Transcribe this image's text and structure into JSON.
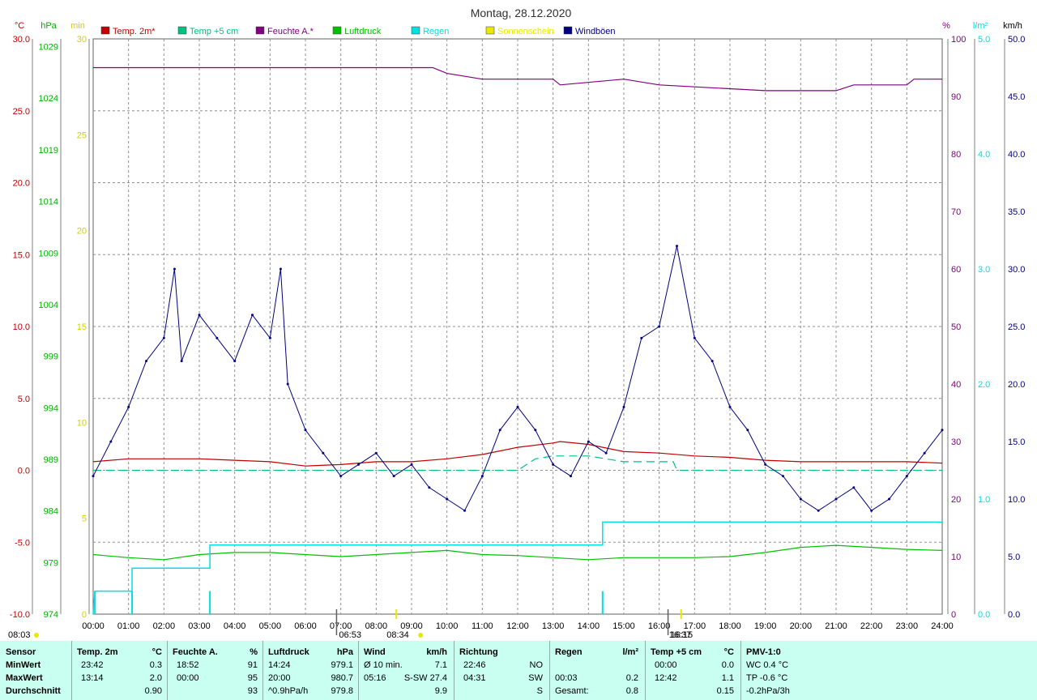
{
  "title": "Montag, 28.12.2020",
  "units": {
    "temp": "°C",
    "pressure": "hPa",
    "sun": "min",
    "humidity": "%",
    "rain": "l/m²",
    "wind": "km/h"
  },
  "legend": [
    {
      "label": "Temp. 2m*",
      "color": "#c00000"
    },
    {
      "label": "Temp +5 cm",
      "color": "#00c080"
    },
    {
      "label": "Feuchte A.*",
      "color": "#800080"
    },
    {
      "label": "Luftdruck",
      "color": "#00c000"
    },
    {
      "label": "Regen",
      "color": "#00e0e0"
    },
    {
      "label": "Sonnenschein",
      "color": "#e8e800"
    },
    {
      "label": "Windböen",
      "color": "#000080"
    }
  ],
  "axes": {
    "temp_ticks": [
      "30.0",
      "25.0",
      "20.0",
      "15.0",
      "10.0",
      "5.0",
      "0.0",
      "-5.0",
      "-10.0"
    ],
    "pressure_ticks": [
      "1029",
      "1024",
      "1019",
      "1014",
      "1009",
      "1004",
      "999",
      "994",
      "989",
      "984",
      "979",
      "974"
    ],
    "sun_ticks": [
      "30",
      "25",
      "20",
      "15",
      "10",
      "5",
      "0"
    ],
    "humidity_ticks": [
      "100",
      "90",
      "80",
      "70",
      "60",
      "50",
      "40",
      "30",
      "20",
      "10",
      "0"
    ],
    "rain_ticks": [
      "5.0",
      "4.0",
      "3.0",
      "2.0",
      "1.0",
      "0.0"
    ],
    "wind_ticks": [
      "50.0",
      "45.0",
      "40.0",
      "35.0",
      "30.0",
      "25.0",
      "20.0",
      "15.0",
      "10.0",
      "5.0",
      "0.0"
    ],
    "hours": [
      "00:00",
      "01:00",
      "02:00",
      "03:00",
      "04:00",
      "05:00",
      "06:00",
      "07:00",
      "08:00",
      "09:00",
      "10:00",
      "11:00",
      "12:00",
      "13:00",
      "14:00",
      "15:00",
      "16:00",
      "17:00",
      "18:00",
      "19:00",
      "20:00",
      "21:00",
      "22:00",
      "23:00",
      "24:00"
    ],
    "sun_events": {
      "left": "08:03",
      "sunrise": "06:53",
      "sunrise2": "08:34",
      "sunset": "16:15",
      "sunset2": "16:37"
    }
  },
  "chart_data": {
    "type": "line",
    "x_unit": "hour of day",
    "xlim": [
      0,
      24
    ],
    "series": [
      {
        "name": "Temp. 2m*",
        "unit": "°C",
        "ylim": [
          -10,
          30
        ],
        "points": [
          [
            0,
            0.6
          ],
          [
            1,
            0.8
          ],
          [
            2,
            0.8
          ],
          [
            3,
            0.8
          ],
          [
            4,
            0.7
          ],
          [
            5,
            0.6
          ],
          [
            6,
            0.3
          ],
          [
            7,
            0.4
          ],
          [
            8,
            0.6
          ],
          [
            9,
            0.6
          ],
          [
            10,
            0.8
          ],
          [
            11,
            1.1
          ],
          [
            12,
            1.6
          ],
          [
            13,
            1.9
          ],
          [
            13.2,
            2.0
          ],
          [
            14,
            1.8
          ],
          [
            15,
            1.3
          ],
          [
            16,
            1.2
          ],
          [
            17,
            1.0
          ],
          [
            18,
            0.9
          ],
          [
            19,
            0.7
          ],
          [
            20,
            0.6
          ],
          [
            21,
            0.6
          ],
          [
            22,
            0.6
          ],
          [
            23,
            0.6
          ],
          [
            24,
            0.5
          ]
        ]
      },
      {
        "name": "Temp +5 cm",
        "unit": "°C",
        "ylim": [
          -10,
          30
        ],
        "points": [
          [
            0,
            0.0
          ],
          [
            12,
            0.0
          ],
          [
            12.5,
            0.8
          ],
          [
            13,
            1.0
          ],
          [
            14,
            1.0
          ],
          [
            15,
            0.6
          ],
          [
            16.4,
            0.6
          ],
          [
            16.5,
            0.0
          ],
          [
            24,
            0.0
          ]
        ]
      },
      {
        "name": "Feuchte A.*",
        "unit": "%",
        "ylim": [
          0,
          100
        ],
        "points": [
          [
            0,
            95
          ],
          [
            9.6,
            95
          ],
          [
            10,
            94
          ],
          [
            11,
            93
          ],
          [
            13,
            93
          ],
          [
            13.2,
            92
          ],
          [
            15,
            93
          ],
          [
            16,
            92
          ],
          [
            19,
            91
          ],
          [
            21,
            91
          ],
          [
            21.5,
            92
          ],
          [
            23,
            92
          ],
          [
            23.2,
            93
          ],
          [
            24,
            93
          ]
        ]
      },
      {
        "name": "Luftdruck",
        "unit": "hPa",
        "ylim": [
          974,
          1030
        ],
        "points": [
          [
            0,
            979.8
          ],
          [
            1,
            979.5
          ],
          [
            2,
            979.3
          ],
          [
            3,
            979.8
          ],
          [
            4,
            980.0
          ],
          [
            5,
            980.0
          ],
          [
            6,
            979.8
          ],
          [
            7,
            979.6
          ],
          [
            8,
            979.8
          ],
          [
            9,
            980.0
          ],
          [
            10,
            980.2
          ],
          [
            11,
            979.8
          ],
          [
            12,
            979.7
          ],
          [
            13,
            979.5
          ],
          [
            14,
            979.3
          ],
          [
            15,
            979.5
          ],
          [
            16,
            979.5
          ],
          [
            17,
            979.5
          ],
          [
            18,
            979.6
          ],
          [
            19,
            980.0
          ],
          [
            20,
            980.5
          ],
          [
            21,
            980.7
          ],
          [
            22,
            980.5
          ],
          [
            23,
            980.3
          ],
          [
            24,
            980.2
          ]
        ]
      },
      {
        "name": "Regen",
        "unit": "l/m²",
        "ylim": [
          0,
          5
        ],
        "points": [
          [
            0,
            0
          ],
          [
            0.05,
            0.2
          ],
          [
            1.1,
            0.2
          ],
          [
            1.1,
            0.4
          ],
          [
            3.3,
            0.4
          ],
          [
            3.3,
            0.6
          ],
          [
            14.4,
            0.6
          ],
          [
            14.4,
            0.8
          ],
          [
            24,
            0.8
          ]
        ]
      },
      {
        "name": "Windböen",
        "unit": "km/h",
        "ylim": [
          0,
          50
        ],
        "points": [
          [
            0,
            12
          ],
          [
            0.5,
            15
          ],
          [
            1,
            18
          ],
          [
            1.5,
            22
          ],
          [
            2,
            24
          ],
          [
            2.3,
            30
          ],
          [
            2.5,
            22
          ],
          [
            3,
            26
          ],
          [
            3.5,
            24
          ],
          [
            4,
            22
          ],
          [
            4.5,
            26
          ],
          [
            5,
            24
          ],
          [
            5.3,
            30
          ],
          [
            5.5,
            20
          ],
          [
            6,
            16
          ],
          [
            6.5,
            14
          ],
          [
            7,
            12
          ],
          [
            7.5,
            13
          ],
          [
            8,
            14
          ],
          [
            8.5,
            12
          ],
          [
            9,
            13
          ],
          [
            9.5,
            11
          ],
          [
            10,
            10
          ],
          [
            10.5,
            9
          ],
          [
            11,
            12
          ],
          [
            11.5,
            16
          ],
          [
            12,
            18
          ],
          [
            12.5,
            16
          ],
          [
            13,
            13
          ],
          [
            13.5,
            12
          ],
          [
            14,
            15
          ],
          [
            14.5,
            14
          ],
          [
            15,
            18
          ],
          [
            15.5,
            24
          ],
          [
            16,
            25
          ],
          [
            16.5,
            32
          ],
          [
            17,
            24
          ],
          [
            17.5,
            22
          ],
          [
            18,
            18
          ],
          [
            18.5,
            16
          ],
          [
            19,
            13
          ],
          [
            19.5,
            12
          ],
          [
            20,
            10
          ],
          [
            20.5,
            9
          ],
          [
            21,
            10
          ],
          [
            21.5,
            11
          ],
          [
            22,
            9
          ],
          [
            22.5,
            10
          ],
          [
            23,
            12
          ],
          [
            23.5,
            14
          ],
          [
            24,
            16
          ]
        ]
      }
    ],
    "bars": [
      {
        "name": "Regen",
        "unit": "l/m²",
        "x": [
          0.05,
          1.1,
          3.3,
          14.4
        ],
        "values": [
          0.2,
          0.2,
          0.2,
          0.2
        ]
      }
    ]
  },
  "stats": {
    "headers": {
      "sensor": "Sensor",
      "temp": "Temp. 2m",
      "temp_u": "°C",
      "hum": "Feuchte A.",
      "hum_u": "%",
      "pres": "Luftdruck",
      "pres_u": "hPa",
      "wind": "Wind",
      "wind_u": "km/h",
      "dir": "Richtung",
      "rain": "Regen",
      "rain_u": "l/m²",
      "t5": "Temp +5 cm",
      "t5_u": "°C",
      "pmv": "PMV-1:0"
    },
    "rows": [
      {
        "label": "MinWert",
        "temp_t": "23:42",
        "temp_v": "0.3",
        "hum_t": "18:52",
        "hum_v": "91",
        "pres_t": "14:24",
        "pres_v": "979.1",
        "wind_t": "Ø 10 min.",
        "wind_v": "7.1",
        "dir_t": "22:46",
        "dir_v": "NO",
        "rain_t": "",
        "rain_v": "",
        "t5_t": "00:00",
        "t5_v": "0.0",
        "pmv": "WC 0.4 °C"
      },
      {
        "label": "MaxWert",
        "temp_t": "13:14",
        "temp_v": "2.0",
        "hum_t": "00:00",
        "hum_v": "95",
        "pres_t": "20:00",
        "pres_v": "980.7",
        "wind_t": "05:16",
        "wind_v": "S-SW 27.4",
        "dir_t": "04:31",
        "dir_v": "SW",
        "rain_t": "00:03",
        "rain_v": "0.2",
        "t5_t": "12:42",
        "t5_v": "1.1",
        "pmv": "TP -0.6 °C"
      },
      {
        "label": "Durchschnitt",
        "temp_t": "",
        "temp_v": "0.90",
        "hum_t": "",
        "hum_v": "93",
        "pres_t": "^0.9hPa/h",
        "pres_v": "979.8",
        "wind_t": "",
        "wind_v": "9.9",
        "dir_t": "",
        "dir_v": "S",
        "rain_t": "Gesamt:",
        "rain_v": "0.8",
        "t5_t": "",
        "t5_v": "0.15",
        "pmv": "-0.2hPa/3h"
      }
    ]
  }
}
